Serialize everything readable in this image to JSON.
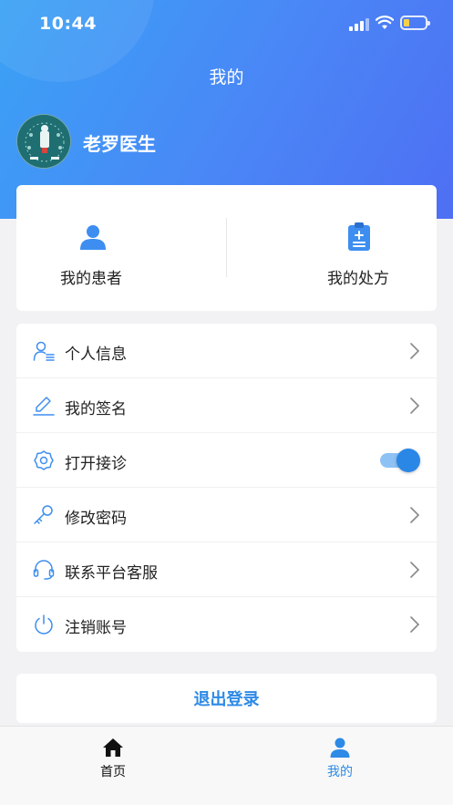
{
  "status_bar": {
    "time": "10:44"
  },
  "header": {
    "title": "我的"
  },
  "profile": {
    "name": "老罗医生"
  },
  "quick_actions": [
    {
      "label": "我的患者",
      "icon": "patients-icon"
    },
    {
      "label": "我的处方",
      "icon": "prescription-icon"
    }
  ],
  "menu": [
    {
      "label": "个人信息",
      "icon": "user-info-icon"
    },
    {
      "label": "我的签名",
      "icon": "pen-icon"
    },
    {
      "label": "打开接诊",
      "icon": "gear-icon",
      "toggle_on": true
    },
    {
      "label": "修改密码",
      "icon": "key-icon"
    },
    {
      "label": "联系平台客服",
      "icon": "headset-icon"
    },
    {
      "label": "注销账号",
      "icon": "power-icon"
    }
  ],
  "logout": {
    "label": "退出登录"
  },
  "tabbar": [
    {
      "label": "首页",
      "icon": "home-icon"
    },
    {
      "label": "我的",
      "icon": "person-icon",
      "active": true
    }
  ],
  "colors": {
    "accent": "#2d8ae6",
    "header_start": "#3aa2f5",
    "header_end": "#4e6ff3"
  }
}
